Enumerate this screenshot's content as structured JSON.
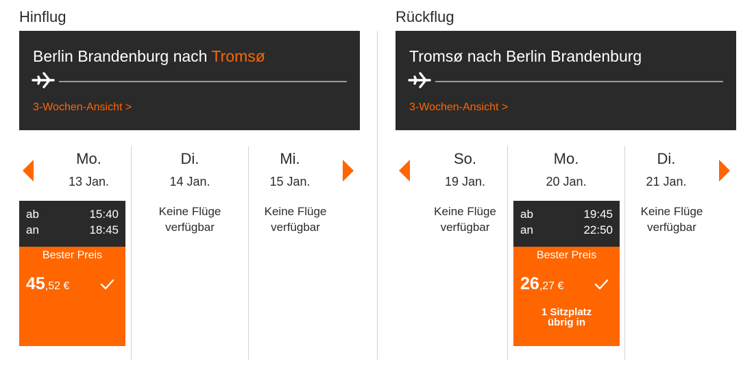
{
  "outbound": {
    "section_title": "Hinflug",
    "route_prefix": "Berlin Brandenburg nach ",
    "route_dest": "Tromsø",
    "three_week_link": "3-Wochen-Ansicht >",
    "days": [
      {
        "name": "Mo.",
        "date": "13 Jan.",
        "departure_label": "ab",
        "departure_time": "15:40",
        "arrival_label": "an",
        "arrival_time": "18:45",
        "badge": "Bester Preis",
        "price_main": "45",
        "price_cents": ",52 €"
      },
      {
        "name": "Di.",
        "date": "14 Jan.",
        "no_flights_line1": "Keine Flüge",
        "no_flights_line2": "verfügbar"
      },
      {
        "name": "Mi.",
        "date": "15 Jan.",
        "no_flights_line1": "Keine Flüge",
        "no_flights_line2": "verfügbar"
      }
    ]
  },
  "return": {
    "section_title": "Rückflug",
    "route_text": "Tromsø nach Berlin Brandenburg",
    "three_week_link": "3-Wochen-Ansicht >",
    "days": [
      {
        "name": "So.",
        "date": "19 Jan.",
        "no_flights_line1": "Keine Flüge",
        "no_flights_line2": "verfügbar"
      },
      {
        "name": "Mo.",
        "date": "20 Jan.",
        "departure_label": "ab",
        "departure_time": "19:45",
        "arrival_label": "an",
        "arrival_time": "22:50",
        "badge": "Bester Preis",
        "price_main": "26",
        "price_cents": ",27 €",
        "seats_line1": "1 Sitzplatz",
        "seats_line2": "übrig in"
      },
      {
        "name": "Di.",
        "date": "21 Jan.",
        "no_flights_line1": "Keine Flüge",
        "no_flights_line2": "verfügbar"
      }
    ]
  },
  "icons": {
    "plane": "plane-icon",
    "check": "check-icon",
    "prev": "chevron-left-icon",
    "next": "chevron-right-icon"
  },
  "colors": {
    "accent": "#ff6600",
    "dark": "#2a2a2a",
    "text": "#2b2b2b",
    "divider": "#d3d3d3"
  }
}
